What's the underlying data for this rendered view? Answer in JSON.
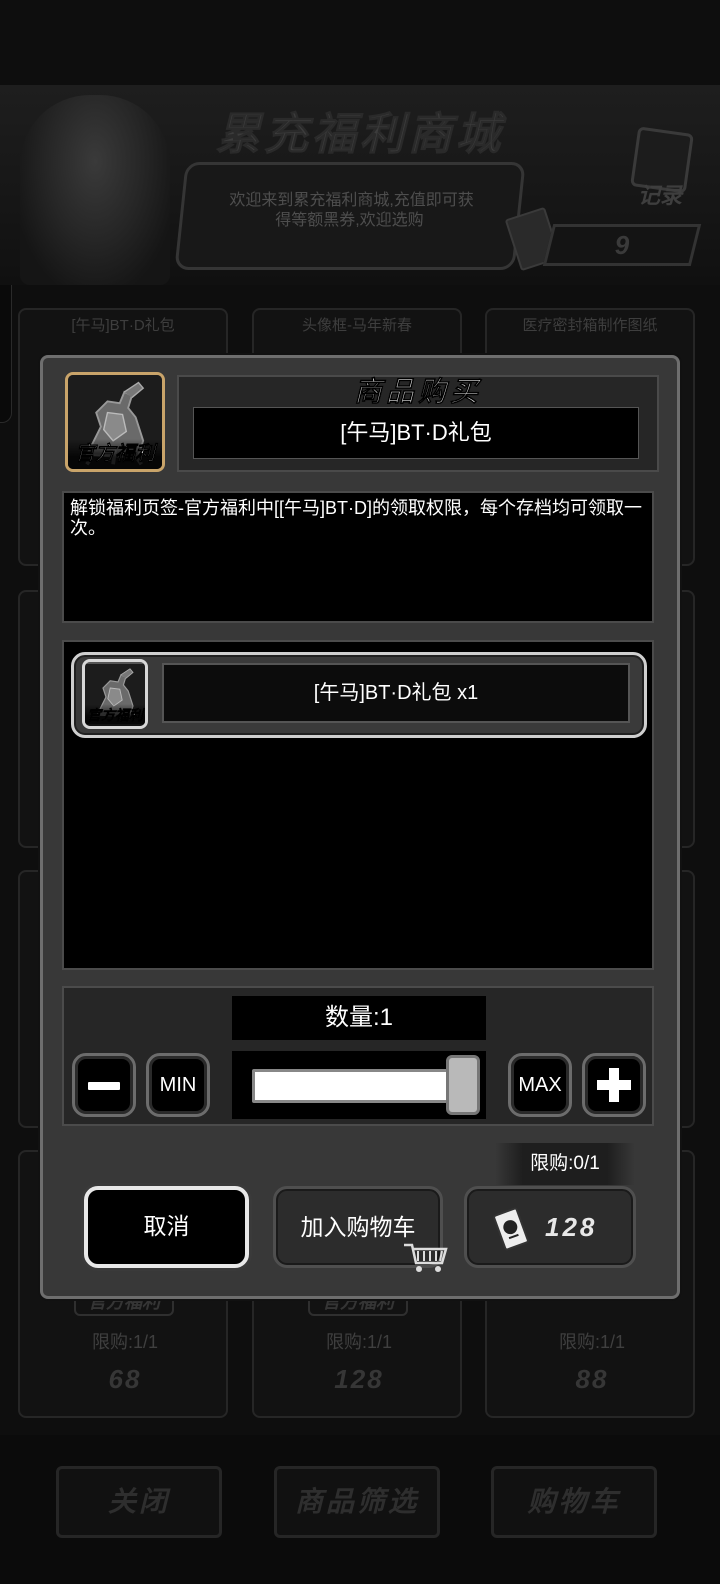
{
  "background": {
    "title": "累充福利商城",
    "welcome_text_line1": "欢迎来到累充福利商城,充值即可获",
    "welcome_text_line2": "得等额黑券,欢迎选购",
    "record_label": "记录",
    "ticket_balance": "9",
    "cards": [
      {
        "label": "[午马]BT·D礼包",
        "badge": "官方福利",
        "limit": "限购:1/1",
        "price": "68"
      },
      {
        "label": "头像框-马年新春",
        "badge": "官方福利",
        "limit": "限购:1/1",
        "price": "128"
      },
      {
        "label": "医疗密封箱制作图纸",
        "badge": "",
        "limit": "限购:1/1",
        "price": "88"
      }
    ],
    "bottom_buttons": {
      "close": "关闭",
      "filter": "商品筛选",
      "cart": "购物车"
    }
  },
  "dialog": {
    "title": "商品购买",
    "product_name": "[午马]BT·D礼包",
    "product_icon_caption": "官方福利",
    "description": "解锁福利页签-官方福利中[[午马]BT·D]的领取权限，每个存档均可领取一次。",
    "items": [
      {
        "name": "[午马]BT·D礼包 x1",
        "icon_caption": "官方福利"
      }
    ],
    "quantity_label": "数量:1",
    "quantity_fraction": 1.0,
    "min_label": "MIN",
    "max_label": "MAX",
    "limit_text": "限购:0/1",
    "cancel_label": "取消",
    "add_to_cart_label": "加入购物车",
    "price": "128"
  },
  "icons": {
    "minus": "minus-icon",
    "plus": "plus-icon",
    "ticket": "black-ticket-icon",
    "cart": "shopping-cart-icon"
  }
}
